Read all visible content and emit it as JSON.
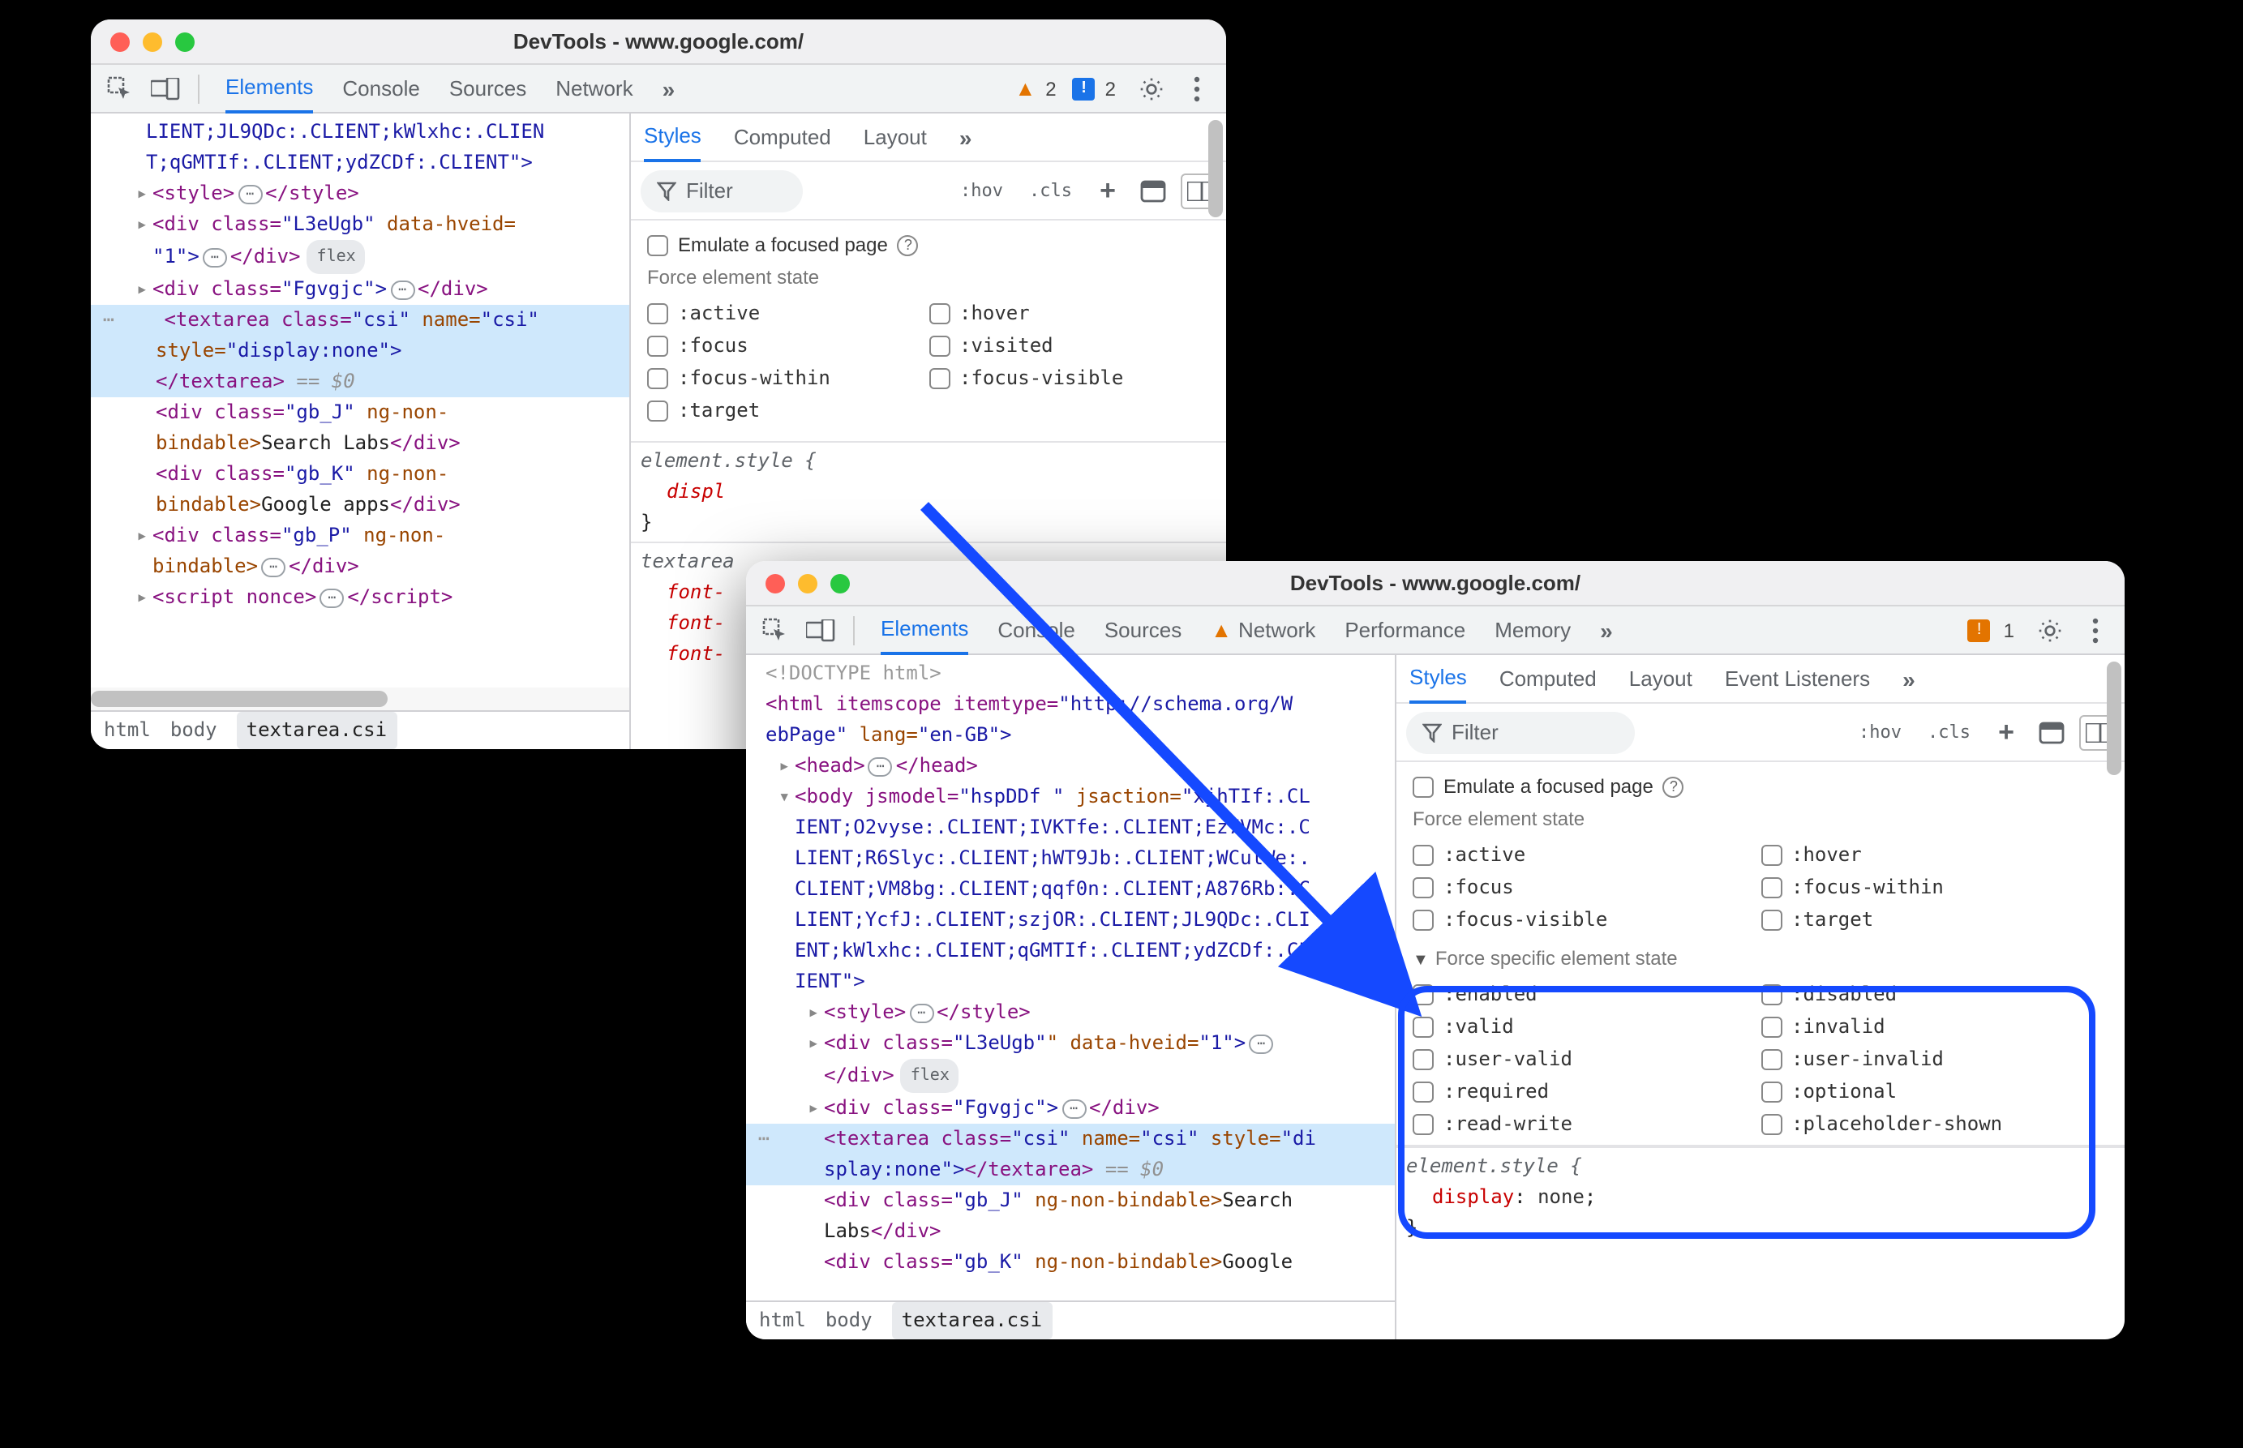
{
  "windowTitle": "DevTools - www.google.com/",
  "mainTabs": [
    "Elements",
    "Console",
    "Sources",
    "Network"
  ],
  "mainTabs2": [
    "Elements",
    "Console",
    "Sources",
    "Network",
    "Performance",
    "Memory"
  ],
  "warnings1": "2",
  "issues1": "2",
  "issues2": "1",
  "stylesTabs": [
    "Styles",
    "Computed",
    "Layout"
  ],
  "stylesTabs2": [
    "Styles",
    "Computed",
    "Layout",
    "Event Listeners"
  ],
  "filterPlaceholder": "Filter",
  "hov": ":hov",
  "cls": ".cls",
  "emulateFocus": "Emulate a focused page",
  "forceState": "Force element state",
  "states1_col1": [
    ":active",
    ":focus",
    ":focus-within",
    ":target"
  ],
  "states1_col2": [
    ":hover",
    ":visited",
    ":focus-visible"
  ],
  "states2_col1": [
    ":active",
    ":focus",
    ":focus-visible"
  ],
  "states2_col2": [
    ":hover",
    ":focus-within",
    ":target"
  ],
  "forceSpecific": "Force specific element state",
  "specific_col1": [
    ":enabled",
    ":valid",
    ":user-valid",
    ":required",
    ":read-write"
  ],
  "specific_col2": [
    ":disabled",
    ":invalid",
    ":user-invalid",
    ":optional",
    ":placeholder-shown"
  ],
  "elStyleSel": "element.style {",
  "displProp": "displ",
  "textareaSel": "textarea",
  "fontProp": "font-",
  "closeBrace": "}",
  "elStyle2_prop": "display",
  "elStyle2_val": "none",
  "breadcrumbs": [
    "html",
    "body",
    "textarea.csi"
  ],
  "dom1": {
    "line1a": "LIENT;JL9QDc:.CLIENT;kWlxhc:.CLIEN",
    "line1b": "T;qGMTIf:.CLIENT;ydZCDf:.CLIENT\">",
    "style_open": "<style>",
    "style_close": "</style>",
    "div1_a": "<div class=",
    "div1_b": "\"L3eUgb\"",
    "div1_c": " data-hveid=",
    "div1_d": "\"1\">",
    "enddiv": "</div>",
    "flex": "flex",
    "div2_a": "<div class=",
    "div2_b": "\"Fgvgjc\">",
    "ta_a": "<textarea class=",
    "ta_b": "\"csi\"",
    "ta_c": " name=",
    "ta_d": "\"csi\"",
    "ta_e": " style=",
    "ta_f": "\"display:none\">",
    "ta_close": "</textarea>",
    "eqd": " == $0",
    "gbj_a": "<div class=",
    "gbj_b": "\"gb_J\"",
    "gbj_c": " ng-non-",
    "gbj_d": "bindable>",
    "gbj_txt": "Search Labs",
    "gbk_a": "<div class=",
    "gbk_b": "\"gb_K\"",
    "gbk_txt": "Google apps",
    "gbp_a": "<div class=",
    "gbp_b": "\"gb_P\"",
    "script_a": "<script nonce>",
    "script_close": "</script>"
  },
  "dom2": {
    "doctype": "<!DOCTYPE html>",
    "html_a": "<html itemscope itemtype=",
    "html_b": "\"http://schema.org/W",
    "html_c": "ebPage\"",
    "html_d": " lang=",
    "html_e": "\"en-GB\">",
    "head_a": "<head>",
    "head_b": "</head>",
    "body_a": "<body jsmodel=",
    "body_b": "\"hspDDf \"",
    "body_c": " jsaction=",
    "body_d": "\"xjhTIf:.CL",
    "body_e": "IENT;O2vyse:.CLIENT;IVKTfe:.CLIENT;Ez7VMc:.C",
    "body_f": "LIENT;R6Slyc:.CLIENT;hWT9Jb:.CLIENT;WCulWe:.",
    "body_g": "CLIENT;VM8bg:.CLIENT;qqf0n:.CLIENT;A876Rb:.C",
    "body_h": "LIENT;YcfJ:.CLIENT;szjOR:.CLIENT;JL9QDc:.CLI",
    "body_i": "ENT;kWlxhc:.CLIENT;qGMTIf:.CLIENT;ydZCDf:.CL",
    "body_j": "IENT\">",
    "div1c": "\" data-hveid=",
    "div1d": "\"1\">",
    "ta_style": " style=",
    "ta_stylev": "\"di",
    "ta_stylev2": "splay:none\">",
    "gbj_txt": "Search",
    "gbj_txt2": "Labs",
    "gbk_txt": "Google"
  }
}
